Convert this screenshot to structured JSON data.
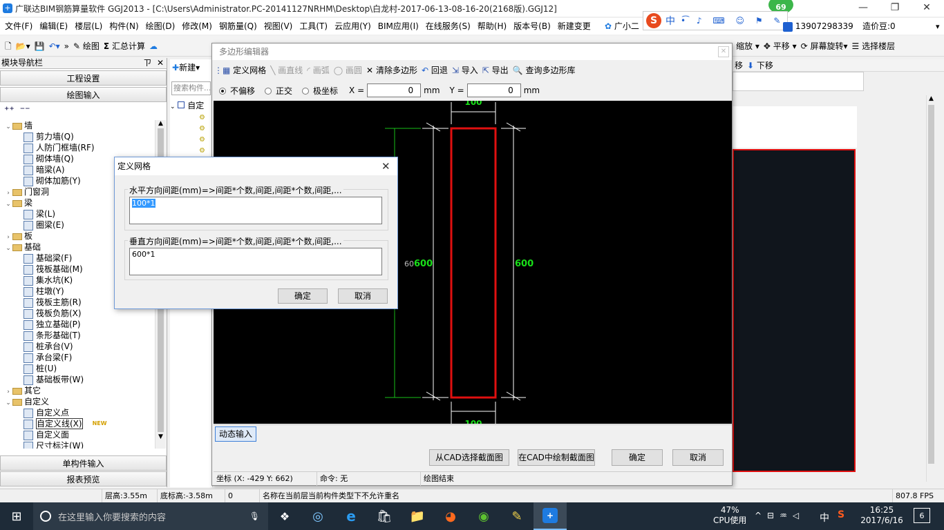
{
  "app": {
    "title": "广联达BIM钢筋算量软件 GGJ2013 - [C:\\Users\\Administrator.PC-20141127NRHM\\Desktop\\白龙村-2017-06-13-08-16-20(2168版).GGJ12]",
    "badge": "69",
    "ime": "中",
    "xiaoer": "广小二",
    "user": "13907298339",
    "price_bean": "造价豆:0"
  },
  "menu": [
    "文件(F)",
    "编辑(E)",
    "楼层(L)",
    "构件(N)",
    "绘图(D)",
    "修改(M)",
    "钢筋量(Q)",
    "视图(V)",
    "工具(T)",
    "云应用(Y)",
    "BIM应用(I)",
    "在线服务(S)",
    "帮助(H)",
    "版本号(B)",
    "新建变更"
  ],
  "toolbar": {
    "draw": "绘图",
    "sum": "汇总计算",
    "zoom": "缩放",
    "pan": "平移",
    "rotate": "屏幕旋转",
    "select_floor": "选择楼层",
    "move": "移",
    "movedown": "下移"
  },
  "left": {
    "header": "模块导航栏",
    "pin": "ㄗ",
    "btn_project": "工程设置",
    "btn_draw": "绘图输入",
    "btn_single": "单构件输入",
    "btn_report": "报表预览",
    "tree": [
      {
        "label": "墙",
        "level": 0,
        "toggle": "⌄",
        "folder": true
      },
      {
        "label": "剪力墙(Q)",
        "level": 1
      },
      {
        "label": "人防门框墙(RF)",
        "level": 1
      },
      {
        "label": "砌体墙(Q)",
        "level": 1
      },
      {
        "label": "暗梁(A)",
        "level": 1
      },
      {
        "label": "砌体加筋(Y)",
        "level": 1
      },
      {
        "label": "门窗洞",
        "level": 0,
        "toggle": "›",
        "folder": true
      },
      {
        "label": "梁",
        "level": 0,
        "toggle": "⌄",
        "folder": true
      },
      {
        "label": "梁(L)",
        "level": 1
      },
      {
        "label": "圈梁(E)",
        "level": 1
      },
      {
        "label": "板",
        "level": 0,
        "toggle": "›",
        "folder": true
      },
      {
        "label": "基础",
        "level": 0,
        "toggle": "⌄",
        "folder": true
      },
      {
        "label": "基础梁(F)",
        "level": 1
      },
      {
        "label": "筏板基础(M)",
        "level": 1
      },
      {
        "label": "集水坑(K)",
        "level": 1
      },
      {
        "label": "柱墩(Y)",
        "level": 1
      },
      {
        "label": "筏板主筋(R)",
        "level": 1
      },
      {
        "label": "筏板负筋(X)",
        "level": 1
      },
      {
        "label": "独立基础(P)",
        "level": 1
      },
      {
        "label": "条形基础(T)",
        "level": 1
      },
      {
        "label": "桩承台(V)",
        "level": 1
      },
      {
        "label": "承台梁(F)",
        "level": 1
      },
      {
        "label": "桩(U)",
        "level": 1
      },
      {
        "label": "基础板带(W)",
        "level": 1
      },
      {
        "label": "其它",
        "level": 0,
        "toggle": "›",
        "folder": true
      },
      {
        "label": "自定义",
        "level": 0,
        "toggle": "⌄",
        "folder": true
      },
      {
        "label": "自定义点",
        "level": 1
      },
      {
        "label": "自定义线(X)",
        "level": 1,
        "new": "NEW"
      },
      {
        "label": "自定义面",
        "level": 1
      },
      {
        "label": "尺寸标注(W)",
        "level": 1
      }
    ]
  },
  "mid": {
    "new_btn": "新建",
    "search_placeholder": "搜索构件...",
    "tree_root": "自定"
  },
  "poly": {
    "title": "多边形编辑器",
    "tools": {
      "grid": "定义网格",
      "line": "画直线",
      "arc": "画弧",
      "circle": "画圆",
      "clear": "清除多边形",
      "undo": "回退",
      "import": "导入",
      "export": "导出",
      "library": "查询多边形库"
    },
    "snap": {
      "none": "不偏移",
      "ortho": "正交",
      "polar": "极坐标"
    },
    "x_label": "X =",
    "x_value": "0",
    "y_label": "Y =",
    "y_value": "0",
    "unit": "mm",
    "dims": {
      "top": "100",
      "bottom": "100",
      "left_green": "600",
      "left_grey": "60",
      "right": "600"
    },
    "dynamic_input": "动态输入",
    "btn_cad_select": "从CAD选择截面图",
    "btn_cad_draw": "在CAD中绘制截面图",
    "btn_ok": "确定",
    "btn_cancel": "取消",
    "status_coord": "坐标 (X: -429 Y: 662)",
    "status_cmd": "命令: 无",
    "status_end": "绘图结束"
  },
  "grid_dialog": {
    "title": "定义网格",
    "h_label": "水平方向间距(mm)=>间距*个数,间距,间距*个数,间距,...",
    "h_value": "100*1",
    "v_label": "垂直方向间距(mm)=>间距*个数,间距,间距*个数,间距,...",
    "v_value": "600*1",
    "ok": "确定",
    "cancel": "取消"
  },
  "status": {
    "floor_h": "层高:3.55m",
    "bottom_h": "底标高:-3.58m",
    "zero": "0",
    "message": "名称在当前层当前构件类型下不允许重名",
    "fps": "807.8 FPS"
  },
  "taskbar": {
    "search_placeholder": "在这里输入你要搜索的内容",
    "cpu_pct": "47%",
    "cpu_label": "CPU使用",
    "ime": "中",
    "time": "16:25",
    "date": "2017/6/16",
    "notif": "6"
  },
  "colors": {
    "accent": "#1e7be0",
    "cad_red": "#e01010",
    "dim_green": "#19e019",
    "taskbar": "#1e2b38"
  }
}
